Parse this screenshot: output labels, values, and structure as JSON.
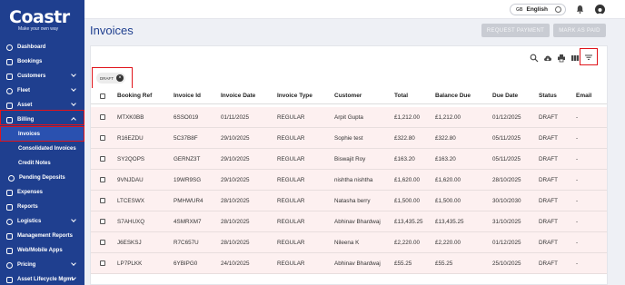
{
  "brand": {
    "name": "Coastr",
    "tagline": "Make your own way"
  },
  "sidebar": {
    "items": [
      {
        "label": "Dashboard",
        "icon": "dashboard-icon"
      },
      {
        "label": "Bookings",
        "icon": "bookings-icon"
      },
      {
        "label": "Customers",
        "icon": "customers-icon",
        "expandable": true
      },
      {
        "label": "Fleet",
        "icon": "fleet-icon",
        "expandable": true
      },
      {
        "label": "Asset",
        "icon": "asset-icon",
        "expandable": true
      },
      {
        "label": "Billing",
        "icon": "billing-icon",
        "expandable": true,
        "expanded": true
      },
      {
        "label": "Invoices",
        "icon": "invoices-icon",
        "sub": true,
        "active": true
      },
      {
        "label": "Consolidated Invoices",
        "icon": "consolidated-icon",
        "sub": true
      },
      {
        "label": "Credit Notes",
        "icon": "credit-notes-icon",
        "sub": true
      },
      {
        "label": "Pending Deposits",
        "icon": "deposits-icon",
        "sub2": true
      },
      {
        "label": "Expenses",
        "icon": "expenses-icon"
      },
      {
        "label": "Reports",
        "icon": "reports-icon"
      },
      {
        "label": "Logistics",
        "icon": "logistics-icon",
        "expandable": true
      },
      {
        "label": "Management Reports",
        "icon": "management-reports-icon"
      },
      {
        "label": "Web/Mobile Apps",
        "icon": "apps-icon"
      },
      {
        "label": "Pricing",
        "icon": "pricing-icon",
        "expandable": true
      },
      {
        "label": "Asset Lifecycle Mgmt",
        "icon": "lifecycle-icon",
        "expandable": true
      }
    ]
  },
  "topbar": {
    "language": "English",
    "flag_label": "GB"
  },
  "header": {
    "title": "Invoices",
    "request_payment": "REQUEST PAYMENT",
    "mark_as_paid": "MARK AS PAID"
  },
  "filter_chip": {
    "label": "DRAFT"
  },
  "table": {
    "columns": [
      "Booking Ref",
      "Invoice Id",
      "Invoice Date",
      "Invoice Type",
      "Customer",
      "Total",
      "Balance Due",
      "Due Date",
      "Status",
      "Email"
    ],
    "rows": [
      [
        "MTXK0BB",
        "6SSO019",
        "01/11/2025",
        "REGULAR",
        "Arpit Gupta",
        "£1,212.00",
        "£1,212.00",
        "01/12/2025",
        "DRAFT",
        "-"
      ],
      [
        "R16EZDU",
        "5C37B8F",
        "29/10/2025",
        "REGULAR",
        "Sophie test",
        "£322.80",
        "£322.80",
        "05/11/2025",
        "DRAFT",
        "-"
      ],
      [
        "SY2QOPS",
        "GERNZ3T",
        "29/10/2025",
        "REGULAR",
        "Biswajit Roy",
        "£163.20",
        "£163.20",
        "05/11/2025",
        "DRAFT",
        "-"
      ],
      [
        "9VNJDAU",
        "19WR9SG",
        "29/10/2025",
        "REGULAR",
        "nishtha nishtha",
        "£1,620.00",
        "£1,620.00",
        "28/10/2025",
        "DRAFT",
        "-"
      ],
      [
        "LTCESWX",
        "PMHWUR4",
        "28/10/2025",
        "REGULAR",
        "Natasha berry",
        "£1,500.00",
        "£1,500.00",
        "30/10/2030",
        "DRAFT",
        "-"
      ],
      [
        "S7AHUXQ",
        "4SMRXM7",
        "28/10/2025",
        "REGULAR",
        "Abhinav Bhardwaj",
        "£13,435.25",
        "£13,435.25",
        "31/10/2025",
        "DRAFT",
        "-"
      ],
      [
        "J6ESKSJ",
        "R7C657U",
        "28/10/2025",
        "REGULAR",
        "Nileena K",
        "£2,220.00",
        "£2,220.00",
        "01/12/2025",
        "DRAFT",
        "-"
      ],
      [
        "LP7PLKK",
        "6YBIPG0",
        "24/10/2025",
        "REGULAR",
        "Abhinav Bhardwaj",
        "£55.25",
        "£55.25",
        "25/10/2025",
        "DRAFT",
        "-"
      ]
    ]
  },
  "colors": {
    "sidebar": "#1f3f8f",
    "highlight": "#e0141b",
    "row": "#fdf0f0",
    "title": "#1f3f8f"
  }
}
